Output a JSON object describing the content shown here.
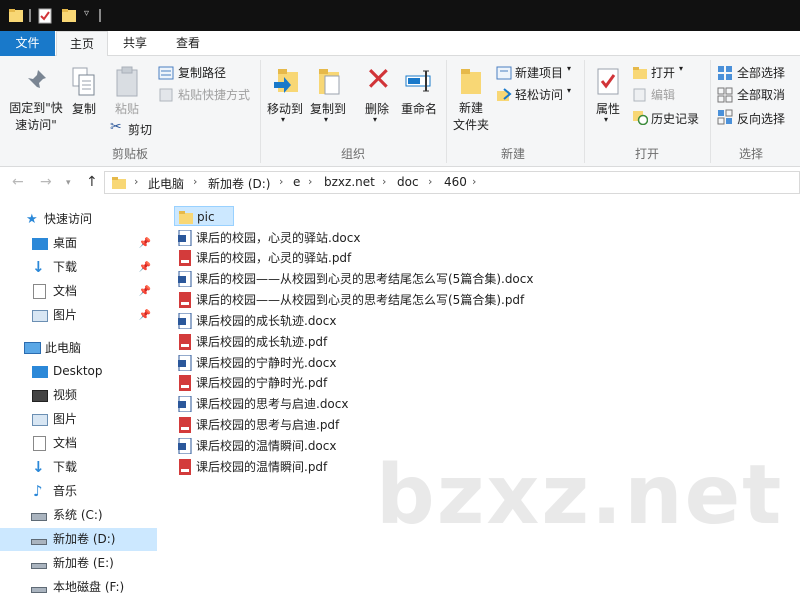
{
  "ribbon_tabs": {
    "file": "文件",
    "home": "主页",
    "share": "共享",
    "view": "查看"
  },
  "ribbon": {
    "clipboard": {
      "pin_quick_access": "固定到\"快\n速访问\"",
      "copy": "复制",
      "paste": "粘贴",
      "copy_path": "复制路径",
      "paste_shortcut": "粘贴快捷方式",
      "cut": "剪切",
      "label": "剪贴板"
    },
    "organize": {
      "move_to": "移动到",
      "copy_to": "复制到",
      "delete": "删除",
      "rename": "重命名",
      "label": "组织"
    },
    "new": {
      "new_folder": "新建\n文件夹",
      "new_item": "新建项目",
      "easy_access": "轻松访问",
      "label": "新建"
    },
    "open": {
      "properties": "属性",
      "open": "打开",
      "edit": "编辑",
      "history": "历史记录",
      "label": "打开"
    },
    "select": {
      "select_all": "全部选择",
      "select_none": "全部取消",
      "invert": "反向选择",
      "label": "选择"
    }
  },
  "breadcrumb": [
    "此电脑",
    "新加卷 (D:)",
    "e",
    "bzxz.net",
    "doc",
    "460"
  ],
  "sidebar": {
    "quick_access": "快速访问",
    "quick_items": [
      "桌面",
      "下载",
      "文档",
      "图片"
    ],
    "this_pc": "此电脑",
    "pc_items": [
      "Desktop",
      "视频",
      "图片",
      "文档",
      "下载",
      "音乐",
      "系统 (C:)",
      "新加卷 (D:)",
      "新加卷 (E:)",
      "本地磁盘 (F:)"
    ]
  },
  "files": [
    {
      "name": "pic",
      "type": "folder"
    },
    {
      "name": "课后的校园，心灵的驿站.docx",
      "type": "docx"
    },
    {
      "name": "课后的校园，心灵的驿站.pdf",
      "type": "pdf"
    },
    {
      "name": "课后的校园——从校园到心灵的思考结尾怎么写(5篇合集).docx",
      "type": "docx"
    },
    {
      "name": "课后的校园——从校园到心灵的思考结尾怎么写(5篇合集).pdf",
      "type": "pdf"
    },
    {
      "name": "课后校园的成长轨迹.docx",
      "type": "docx"
    },
    {
      "name": "课后校园的成长轨迹.pdf",
      "type": "pdf"
    },
    {
      "name": "课后校园的宁静时光.docx",
      "type": "docx"
    },
    {
      "name": "课后校园的宁静时光.pdf",
      "type": "pdf"
    },
    {
      "name": "课后校园的思考与启迪.docx",
      "type": "docx"
    },
    {
      "name": "课后校园的思考与启迪.pdf",
      "type": "pdf"
    },
    {
      "name": "课后校园的温情瞬间.docx",
      "type": "docx"
    },
    {
      "name": "课后校园的温情瞬间.pdf",
      "type": "pdf"
    }
  ],
  "watermark": "bzxz.net",
  "colors": {
    "accent": "#1979ca",
    "selection": "#cce8ff",
    "folder": "#f8d775",
    "pdf": "#d33b3b",
    "docx": "#2b579a"
  }
}
